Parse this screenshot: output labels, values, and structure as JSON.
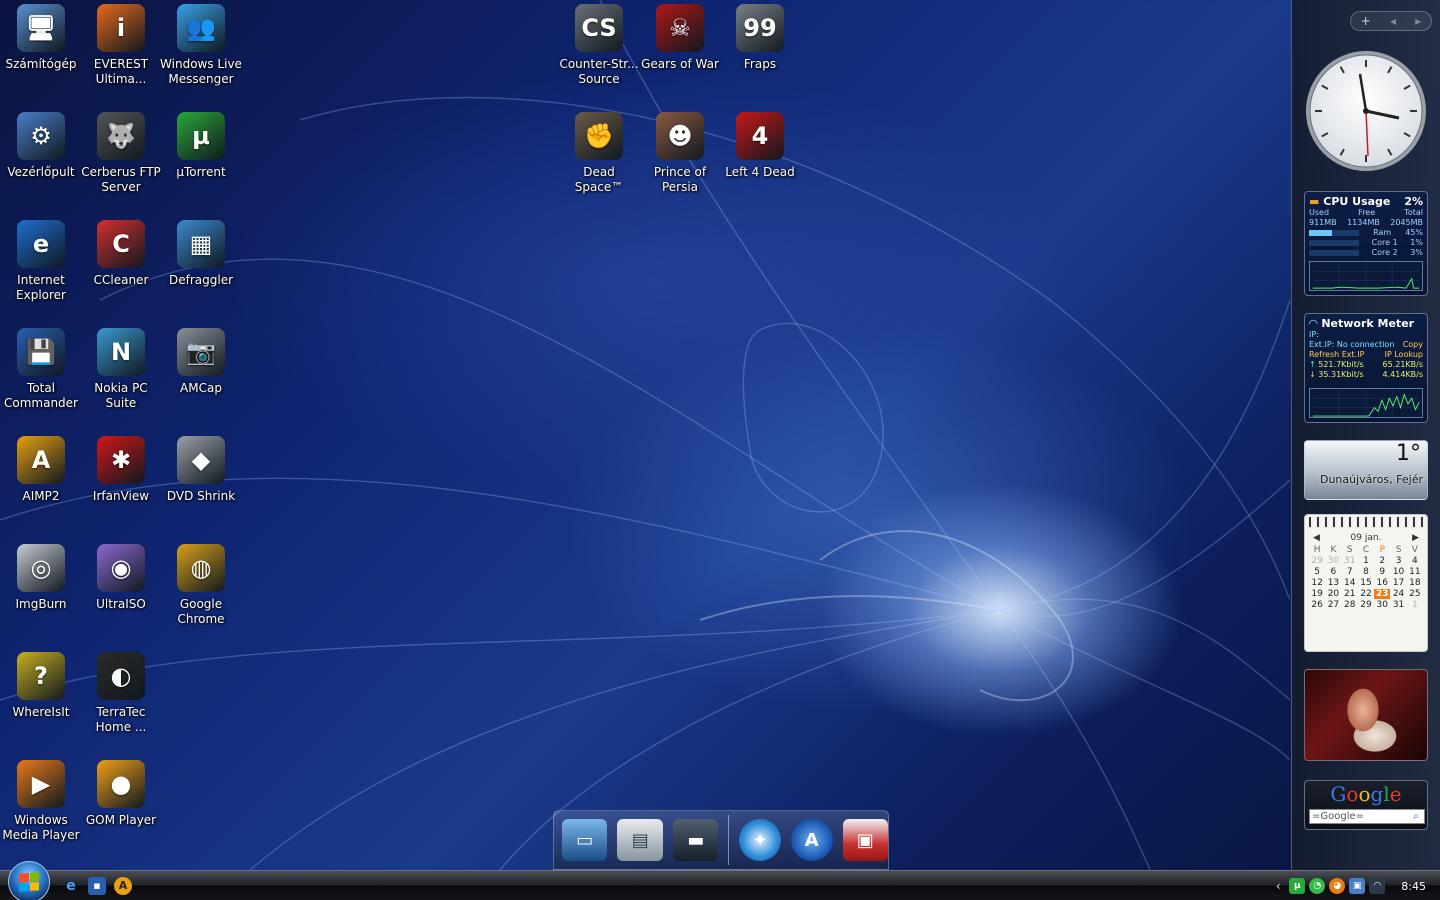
{
  "desktop": {
    "icons": [
      {
        "label": "Számítógép",
        "glyph": "computer-icon",
        "color": "#5a8fd0",
        "char": "🖥"
      },
      {
        "label": "EVEREST Ultima...",
        "glyph": "everest-icon",
        "color": "#e86a1a",
        "char": "i"
      },
      {
        "label": "Windows Live Messenger",
        "glyph": "messenger-icon",
        "color": "#3aa0e8",
        "char": "👥"
      },
      {
        "label": "Vezérlőpult",
        "glyph": "control-panel-icon",
        "color": "#4a7ec8",
        "char": "⚙"
      },
      {
        "label": "Cerberus FTP Server",
        "glyph": "cerberus-icon",
        "color": "#555",
        "char": "🐺"
      },
      {
        "label": "µTorrent",
        "glyph": "utorrent-icon",
        "color": "#2aa83a",
        "char": "µ"
      },
      {
        "label": "Internet Explorer",
        "glyph": "ie-icon",
        "color": "#1f6fd0",
        "char": "e"
      },
      {
        "label": "CCleaner",
        "glyph": "ccleaner-icon",
        "color": "#d03030",
        "char": "C"
      },
      {
        "label": "Defraggler",
        "glyph": "defraggler-icon",
        "color": "#3a8ad0",
        "char": "▦"
      },
      {
        "label": "Total Commander",
        "glyph": "total-commander-icon",
        "color": "#2a5fb0",
        "char": "💾"
      },
      {
        "label": "Nokia PC Suite",
        "glyph": "nokia-icon",
        "color": "#3a9ad0",
        "char": "N"
      },
      {
        "label": "AMCap",
        "glyph": "camera-icon",
        "color": "#8a8f98",
        "char": "📷"
      },
      {
        "label": "AIMP2",
        "glyph": "aimp-icon",
        "color": "#e8a010",
        "char": "A"
      },
      {
        "label": "IrfanView",
        "glyph": "irfanview-icon",
        "color": "#d01818",
        "char": "✱"
      },
      {
        "label": "DVD Shrink",
        "glyph": "dvd-shrink-icon",
        "color": "#9aa0a8",
        "char": "◆"
      },
      {
        "label": "ImgBurn",
        "glyph": "imgburn-icon",
        "color": "#c8ccd4",
        "char": "◎"
      },
      {
        "label": "UltraISO",
        "glyph": "ultraiso-icon",
        "color": "#8a6ad0",
        "char": "◉"
      },
      {
        "label": "Google Chrome",
        "glyph": "chrome-icon",
        "color": "#d8a018",
        "char": "◍"
      },
      {
        "label": "WhereIsIt",
        "glyph": "whereisit-icon",
        "color": "#c8b020",
        "char": "?"
      },
      {
        "label": "TerraTec Home ...",
        "glyph": "terratec-icon",
        "color": "#2a2a2a",
        "char": "◐"
      },
      {
        "label": "Windows Media Player",
        "glyph": "media-player-icon",
        "color": "#e87a18",
        "char": "▶"
      },
      {
        "label": "GOM Player",
        "glyph": "gom-player-icon",
        "color": "#f0a018",
        "char": "●"
      },
      {
        "label": "Counter-Str... Source",
        "glyph": "counter-strike-icon",
        "color": "#6a7078",
        "char": "CS"
      },
      {
        "label": "Gears of War",
        "glyph": "gears-of-war-icon",
        "color": "#b01818",
        "char": "☠"
      },
      {
        "label": "Fraps",
        "glyph": "fraps-icon",
        "color": "#7a8088",
        "char": "99"
      },
      {
        "label": "Dead Space™",
        "glyph": "dead-space-icon",
        "color": "#6a5a48",
        "char": "✊"
      },
      {
        "label": "Prince of Persia",
        "glyph": "prince-of-persia-icon",
        "color": "#8a5a40",
        "char": "☻"
      },
      {
        "label": "Left 4 Dead",
        "glyph": "left4dead-icon",
        "color": "#c81818",
        "char": "4"
      }
    ]
  },
  "sidebar": {
    "top_controls": [
      "+",
      "◂",
      "▸"
    ],
    "cpu": {
      "title": "CPU Usage",
      "percent": "2%",
      "headers": [
        "Used",
        "Free",
        "Total"
      ],
      "values": [
        "911MB",
        "1134MB",
        "2045MB"
      ],
      "ram_label": "Ram",
      "ram_value": "45%",
      "core1_label": "Core 1",
      "core1_value": "1%",
      "core2_label": "Core 2",
      "core2_value": "3%"
    },
    "network": {
      "title": "Network Meter",
      "ip_label": "IP:",
      "ext_ip": "Ext.IP: No connection",
      "copy": "Copy",
      "refresh": "Refresh Ext.IP",
      "lookup": "IP Lookup",
      "up_rate": "521.7Kbit/s",
      "up_bytes": "65.21KB/s",
      "down_rate": "35.31Kbit/s",
      "down_bytes": "4.414KB/s"
    },
    "weather": {
      "temp": "1°",
      "city": "Dunaújváros, Fejér"
    },
    "calendar": {
      "month": "09 jan.",
      "dow": [
        "H",
        "K",
        "S",
        "C",
        "P",
        "S",
        "V"
      ],
      "days": [
        [
          "29",
          "30",
          "31",
          "1",
          "2",
          "3",
          "4"
        ],
        [
          "5",
          "6",
          "7",
          "8",
          "9",
          "10",
          "11"
        ],
        [
          "12",
          "13",
          "14",
          "15",
          "16",
          "17",
          "18"
        ],
        [
          "19",
          "20",
          "21",
          "22",
          "23",
          "24",
          "25"
        ],
        [
          "26",
          "27",
          "28",
          "29",
          "30",
          "31",
          "1"
        ]
      ],
      "today": "23"
    },
    "google": {
      "logo": "Google",
      "placeholder": "=Google="
    }
  },
  "taskbar": {
    "quick_launch": [
      "ie-quicklaunch-icon",
      "save-quicklaunch-icon",
      "aimp-quicklaunch-icon"
    ],
    "tray_chevron": "‹",
    "time": "8:45"
  },
  "colors": {
    "accent": "#2a78c8",
    "calendar_today": "#f07a1a"
  }
}
